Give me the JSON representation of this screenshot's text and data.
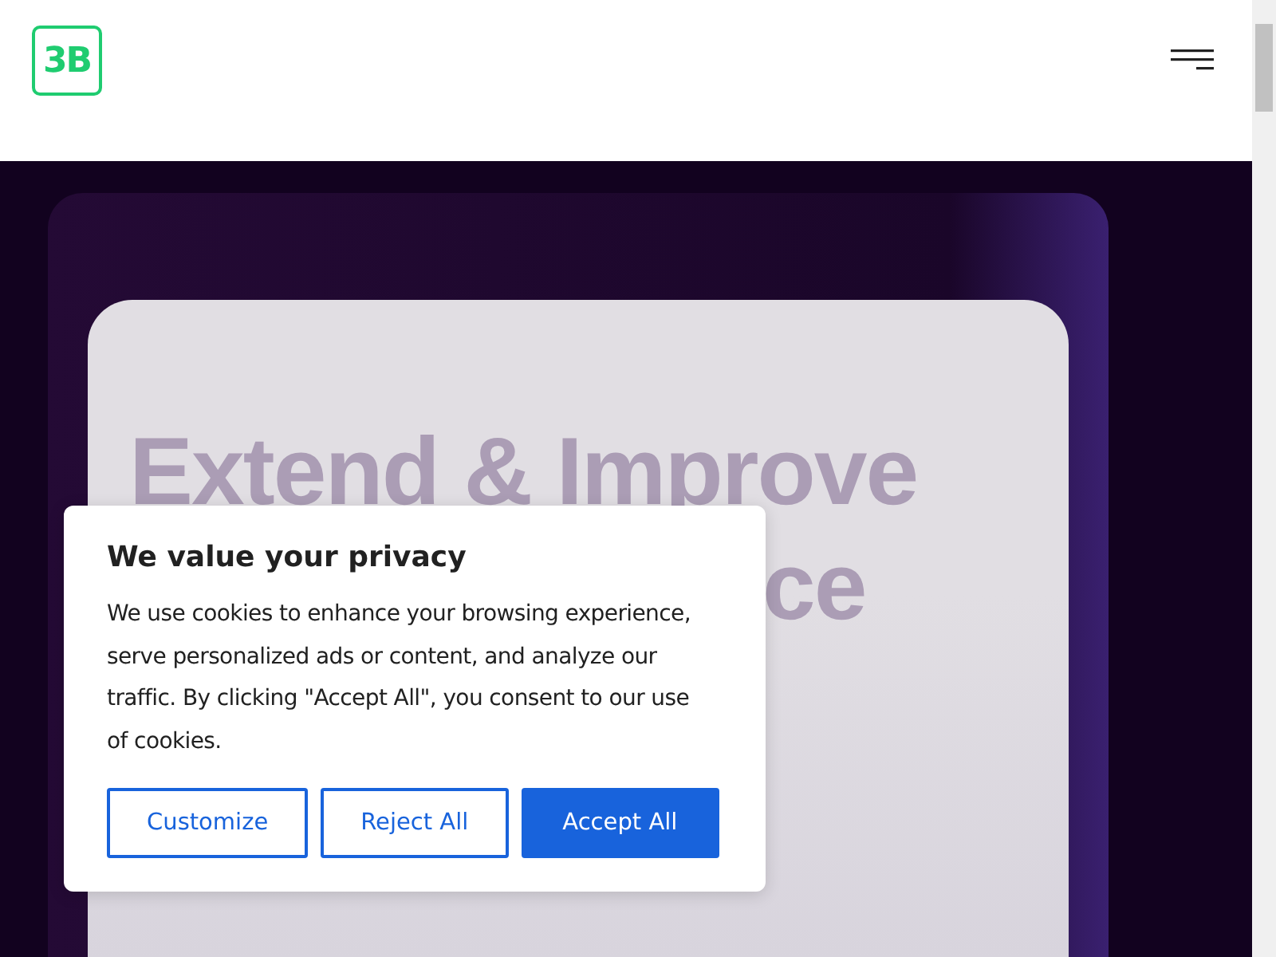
{
  "header": {
    "logo": "3B"
  },
  "hero": {
    "heading_lines": [
      {
        "text": "Extend & Improve",
        "kind": "full"
      },
      {
        "text": "ce",
        "kind": "tail"
      }
    ]
  },
  "cookie_dialog": {
    "title": "We value your privacy",
    "body": "We use cookies to enhance your browsing experience, serve personalized ads or content, and analyze our traffic. By clicking \"Accept All\", you consent to our use of cookies.",
    "buttons": [
      {
        "label": "Customize",
        "kind": "outline"
      },
      {
        "label": "Reject All",
        "kind": "outline"
      },
      {
        "label": "Accept All",
        "kind": "primary"
      }
    ]
  }
}
